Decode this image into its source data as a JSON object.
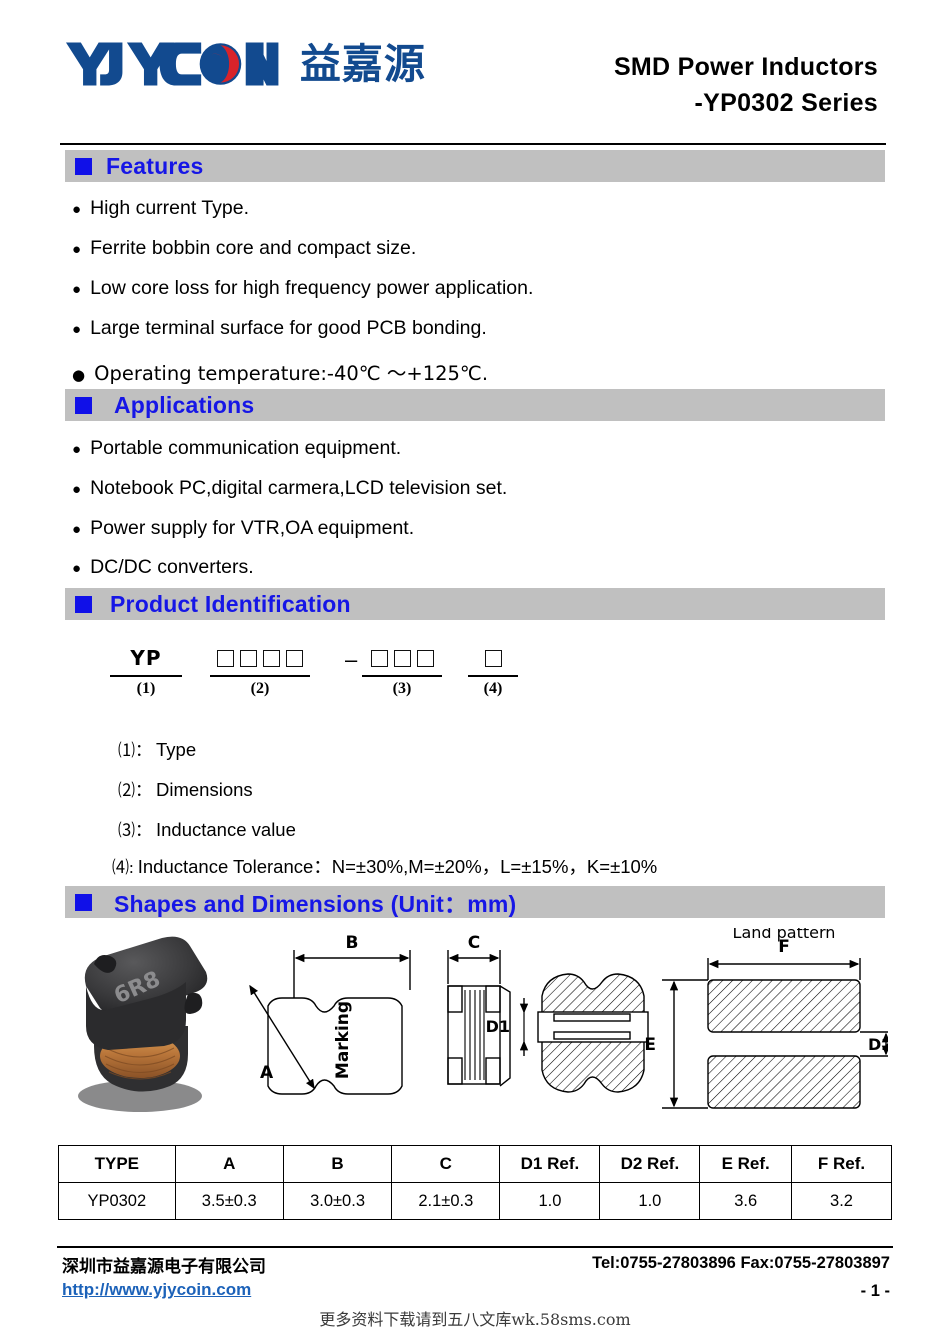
{
  "header": {
    "logo_text": "YJYCOIN",
    "logo_cn": "益嘉源",
    "title_line1": "SMD Power Inductors",
    "title_line2": "-YP0302 Series"
  },
  "sections": {
    "features": {
      "heading": "Features",
      "items": [
        "High current Type.",
        "Ferrite bobbin core and compact size.",
        "Low core loss for high frequency power application.",
        "Large terminal surface for good PCB bonding.",
        "Operating temperature:-40℃ ～+125℃."
      ]
    },
    "applications": {
      "heading": "Applications",
      "items": [
        "Portable communication equipment.",
        "Notebook PC,digital carmera,LCD television set.",
        "Power supply for VTR,OA equipment.",
        "DC/DC converters."
      ]
    },
    "product_identification": {
      "heading": "Product Identification",
      "diagram": {
        "part1_text": "YP",
        "part1_label": "(1)",
        "part2_boxes": 4,
        "part2_label": "(2)",
        "separator": "–",
        "part3_boxes": 3,
        "part3_label": "(3)",
        "part4_boxes": 1,
        "part4_label": "(4)"
      },
      "legend": [
        {
          "index": "⑴：",
          "text": "Type"
        },
        {
          "index": "⑵：",
          "text": "Dimensions"
        },
        {
          "index": "⑶：",
          "text": "Inductance value"
        },
        {
          "index": "⑷:",
          "text": "Inductance Tolerance：N=±30%,M=±20%，L=±15%，K=±10%"
        }
      ]
    },
    "shapes": {
      "heading": "Shapes and Dimensions (Unit：mm)",
      "drawing_labels": {
        "marking": "Marking",
        "a": "A",
        "b": "B",
        "c": "C",
        "d1": "D1",
        "d2": "D2",
        "e": "E",
        "f": "F",
        "land_pattern": "Land pattern",
        "photo_marking": "6R8"
      }
    }
  },
  "table": {
    "columns": [
      "TYPE",
      "A",
      "B",
      "C",
      "D1 Ref.",
      "D2 Ref.",
      "E Ref.",
      "F Ref."
    ],
    "rows": [
      [
        "YP0302",
        "3.5±0.3",
        "3.0±0.3",
        "2.1±0.3",
        "1.0",
        "1.0",
        "3.6",
        "3.2"
      ]
    ]
  },
  "footer": {
    "company_cn": "深圳市益嘉源电子有限公司",
    "url": "http://www.yjycoin.com",
    "contact": "Tel:0755-27803896  Fax:0755-27803897",
    "page": "- 1 -",
    "watermark": "更多资料下载请到五八文库wk.58sms.com"
  },
  "colors": {
    "heading_blue": "#1616e6",
    "bar_gray": "#c0c0c0",
    "link_blue": "#1c62b9",
    "logo_blue": "#124a8f",
    "logo_red": "#d8232a"
  }
}
